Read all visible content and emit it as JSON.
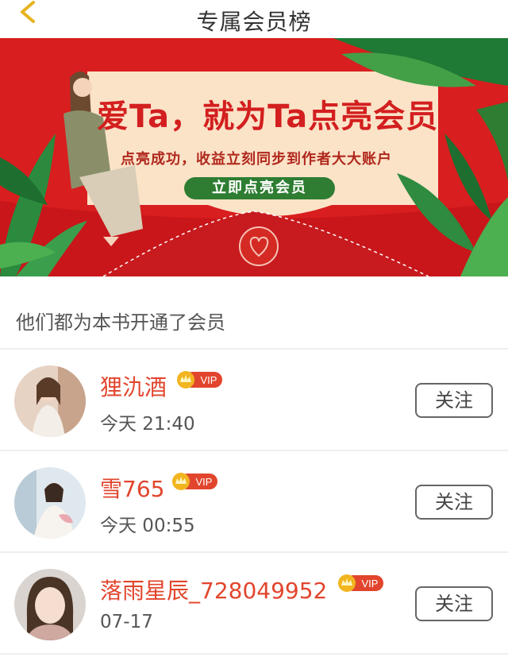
{
  "header": {
    "title": "专属会员榜",
    "back_icon": "chevron-left-icon"
  },
  "banner": {
    "headline": "爱Ta，就为Ta点亮会员",
    "subline": "点亮成功，收益立刻同步到作者大大账户",
    "button_label": "立即点亮会员",
    "colors": {
      "background": "#d81e1e",
      "card": "#fbe3c8",
      "button": "#2e7d32"
    }
  },
  "section": {
    "title": "他们都为本书开通了会员"
  },
  "badge": {
    "label": "VIP",
    "color": "#e2452d",
    "crown_color": "#f2b51f"
  },
  "members": [
    {
      "name": "狸氿酒",
      "time": "今天 21:40",
      "follow_label": "关注"
    },
    {
      "name": "雪765",
      "time": "今天 00:55",
      "follow_label": "关注"
    },
    {
      "name": "落雨星辰_728049952",
      "time": "07-17",
      "follow_label": "关注"
    }
  ]
}
